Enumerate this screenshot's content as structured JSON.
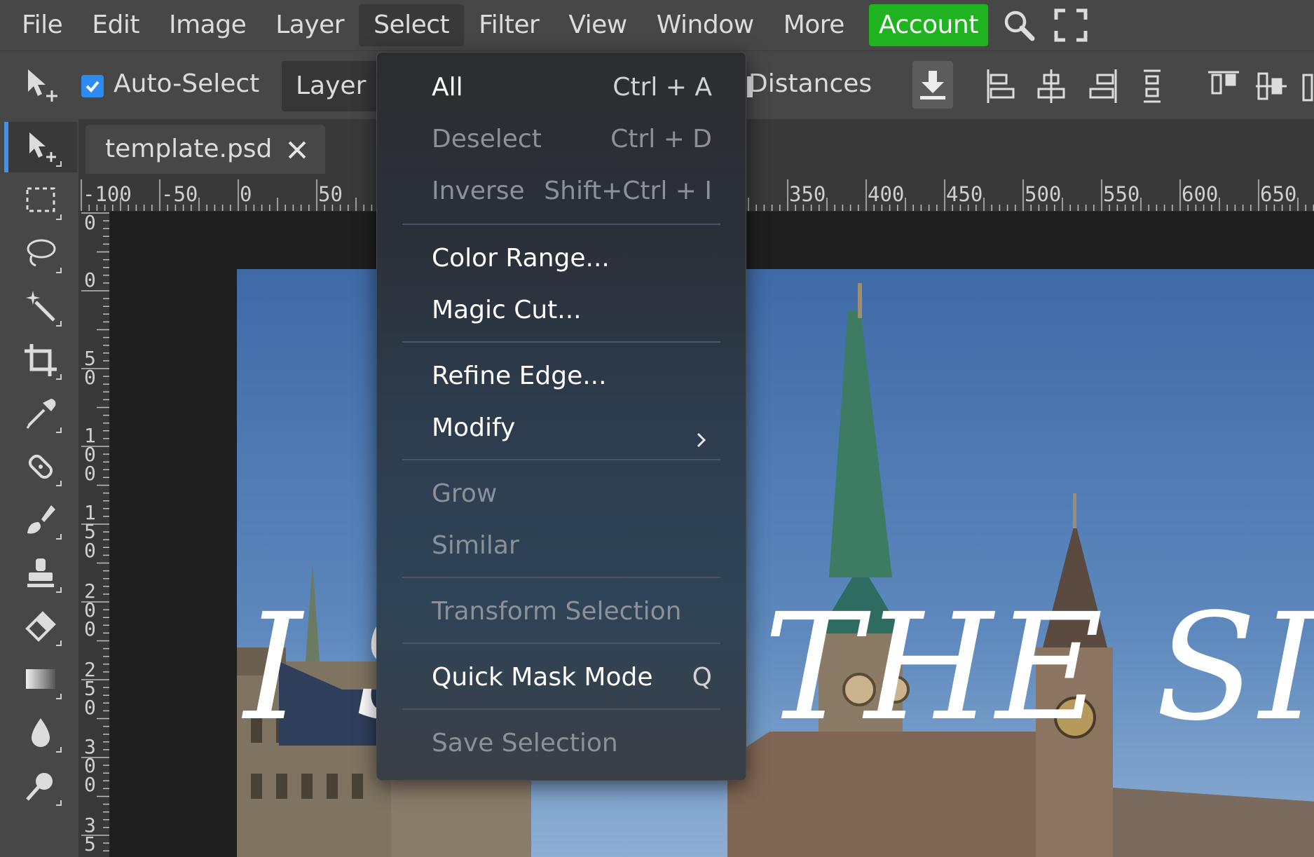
{
  "colors": {
    "accent": "#2d8cf0",
    "account_bg": "#1fb31f",
    "panel": "#474747",
    "dark_panel": "#393939"
  },
  "menubar": {
    "items": [
      "File",
      "Edit",
      "Image",
      "Layer",
      "Select",
      "Filter",
      "View",
      "Window",
      "More"
    ],
    "active": "Select",
    "account": "Account",
    "icons": [
      "search-icon",
      "fullscreen-icon"
    ]
  },
  "options": {
    "auto_select_label": "Auto-Select",
    "auto_select_checked": true,
    "layer_select": "Layer",
    "distances_label": "Distances"
  },
  "tabs": {
    "document": "template.psd"
  },
  "ruler": {
    "h_labels": [
      "-100",
      "-50",
      "0",
      "50",
      "350",
      "400",
      "450",
      "500",
      "550",
      "600",
      "650"
    ],
    "v_labels": [
      "0",
      "0",
      "50",
      "100",
      "150",
      "200",
      "250",
      "300",
      "35"
    ]
  },
  "canvas": {
    "text_first": "I SAW",
    "text_second": "THE SIG"
  },
  "select_menu": {
    "items": [
      {
        "label": "All",
        "shortcut": "Ctrl + A",
        "enabled": true
      },
      {
        "label": "Deselect",
        "shortcut": "Ctrl + D",
        "enabled": false
      },
      {
        "label": "Inverse",
        "shortcut": "Shift+Ctrl + I",
        "enabled": false
      },
      {
        "label": "Color Range...",
        "enabled": true
      },
      {
        "label": "Magic Cut...",
        "enabled": true
      },
      {
        "label": "Refine Edge...",
        "enabled": true
      },
      {
        "label": "Modify",
        "enabled": true,
        "submenu": true
      },
      {
        "label": "Grow",
        "enabled": false
      },
      {
        "label": "Similar",
        "enabled": false
      },
      {
        "label": "Transform Selection",
        "enabled": false
      },
      {
        "label": "Quick Mask Mode",
        "shortcut": "Q",
        "enabled": true
      },
      {
        "label": "Save Selection",
        "enabled": false
      }
    ]
  }
}
